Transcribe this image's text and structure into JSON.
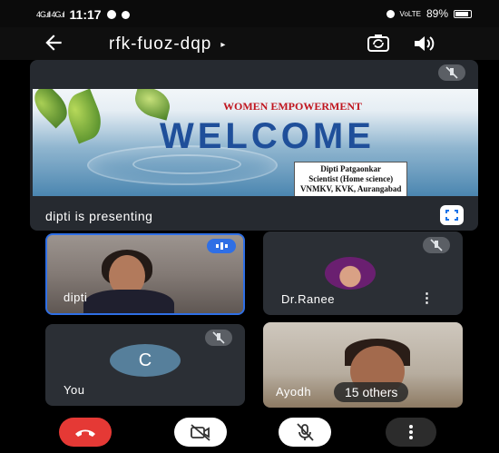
{
  "status_bar": {
    "signal": "4G.ıll 4G.ıl",
    "time": "11:17",
    "battery_label": "89%",
    "network": "VoLTE"
  },
  "app_bar": {
    "back_icon": "arrow-back-icon",
    "meeting_code": "rfk-fuoz-dqp",
    "caret": "▸",
    "icons": [
      "switch-camera-icon",
      "speaker-icon"
    ]
  },
  "presentation": {
    "slide_heading": "WOMEN EMPOWERMENT",
    "slide_title": "WELCOME",
    "presenter_lines": [
      "Dipti Patgaonkar",
      "Scientist (Home science)",
      "VNMKV, KVK, Aurangabad"
    ],
    "label": "dipti is presenting",
    "colors": {
      "heading": "#c0151e",
      "title": "#1f4f9a"
    }
  },
  "tiles": {
    "dipti": {
      "name": "dipti",
      "speaking": true
    },
    "ranee": {
      "name": "Dr.Ranee",
      "muted": true
    },
    "you": {
      "name": "You",
      "initial": "C",
      "muted": true
    },
    "ayodhya": {
      "name": "Ayodh",
      "others": "15 others"
    }
  },
  "controls": {
    "buttons": [
      "hang-up-icon",
      "camera-off-icon",
      "mic-off-icon",
      "more-options-icon"
    ],
    "colors": {
      "hang_up": "#e53935",
      "active": "#ffffff",
      "more": "#2c2c2c"
    }
  }
}
